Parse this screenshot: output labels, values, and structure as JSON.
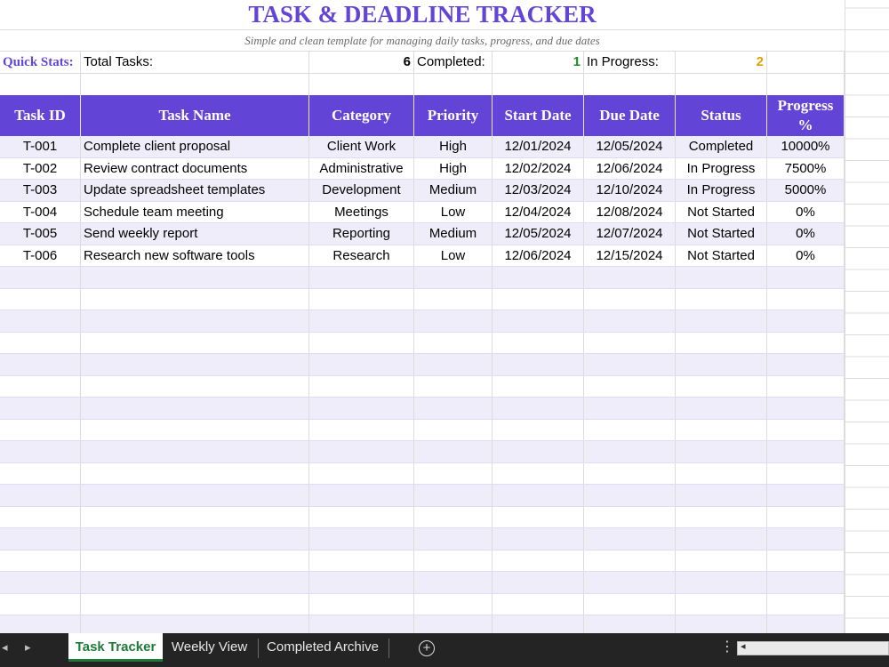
{
  "title": "TASK & DEADLINE TRACKER",
  "subtitle": "Simple and clean template for managing daily tasks, progress, and due dates",
  "stats": {
    "label": "Quick Stats:",
    "total_label": "Total Tasks:",
    "total_value": "6",
    "completed_label": "Completed:",
    "completed_value": "1",
    "inprogress_label": "In Progress:",
    "inprogress_value": "2"
  },
  "colors": {
    "accent": "#6245d6",
    "completed": "#1e8a2e",
    "in_progress": "#e3a000",
    "row_alt": "#f0edfb",
    "active_tab": "#1e7a39"
  },
  "table": {
    "headers": [
      "Task ID",
      "Task Name",
      "Category",
      "Priority",
      "Start Date",
      "Due Date",
      "Status",
      "Progress %"
    ],
    "rows": [
      [
        "T-001",
        "Complete client proposal",
        "Client Work",
        "High",
        "12/01/2024",
        "12/05/2024",
        "Completed",
        "10000%"
      ],
      [
        "T-002",
        "Review contract documents",
        "Administrative",
        "High",
        "12/02/2024",
        "12/06/2024",
        "In Progress",
        "7500%"
      ],
      [
        "T-003",
        "Update spreadsheet templates",
        "Development",
        "Medium",
        "12/03/2024",
        "12/10/2024",
        "In Progress",
        "5000%"
      ],
      [
        "T-004",
        "Schedule team meeting",
        "Meetings",
        "Low",
        "12/04/2024",
        "12/08/2024",
        "Not Started",
        "0%"
      ],
      [
        "T-005",
        "Send weekly report",
        "Reporting",
        "Medium",
        "12/05/2024",
        "12/07/2024",
        "Not Started",
        "0%"
      ],
      [
        "T-006",
        "Research new software tools",
        "Research",
        "Low",
        "12/06/2024",
        "12/15/2024",
        "Not Started",
        "0%"
      ]
    ]
  },
  "tabs": [
    {
      "label": "Task Tracker",
      "active": true
    },
    {
      "label": "Weekly View",
      "active": false
    },
    {
      "label": "Completed Archive",
      "active": false
    }
  ],
  "icons": {
    "prev_sheet": "◂",
    "next_sheet": "▸",
    "add_sheet": "+",
    "more": "⋮",
    "scroll_left": "◂"
  }
}
